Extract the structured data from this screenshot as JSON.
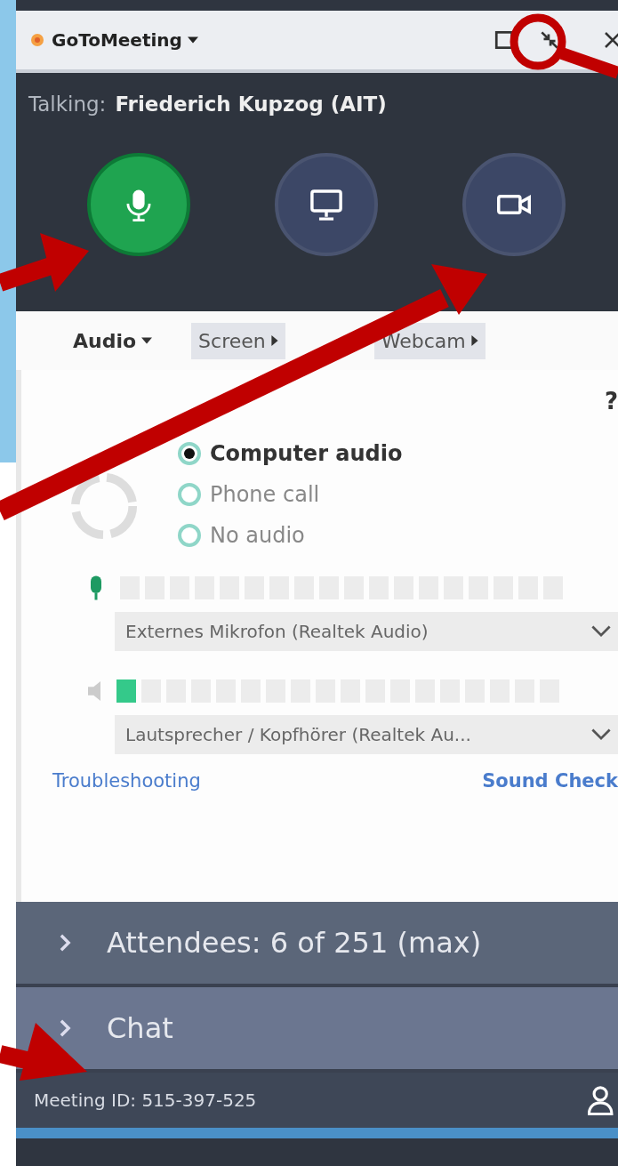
{
  "window": {
    "title": "GoToMeeting"
  },
  "talking": {
    "label": "Talking:",
    "name": "Friederich Kupzog (AIT)"
  },
  "controls": [
    {
      "kind": "microphone",
      "on": true
    },
    {
      "kind": "screen",
      "on": false
    },
    {
      "kind": "webcam",
      "on": false
    }
  ],
  "tabs": [
    {
      "label": "Audio",
      "selected": true
    },
    {
      "label": "Screen",
      "selected": false
    },
    {
      "label": "Webcam",
      "selected": false
    }
  ],
  "help": "?",
  "audio_options": [
    {
      "label": "Computer audio",
      "selected": true
    },
    {
      "label": "Phone call",
      "selected": false
    },
    {
      "label": "No audio",
      "selected": false
    }
  ],
  "microphone": {
    "level": 0,
    "device": "Externes Mikrofon (Realtek Audio)"
  },
  "speaker": {
    "level": 0.06,
    "device": "Lautsprecher / Kopfhörer (Realtek Au..."
  },
  "links": [
    "Troubleshooting",
    "Sound Check"
  ],
  "panels": [
    {
      "label": "Attendees: 6 of 251 (max)",
      "selected": false
    },
    {
      "label": "Chat",
      "selected": true
    }
  ],
  "status_bar": {
    "meeting_id": "Meeting ID: 515-397-525"
  }
}
